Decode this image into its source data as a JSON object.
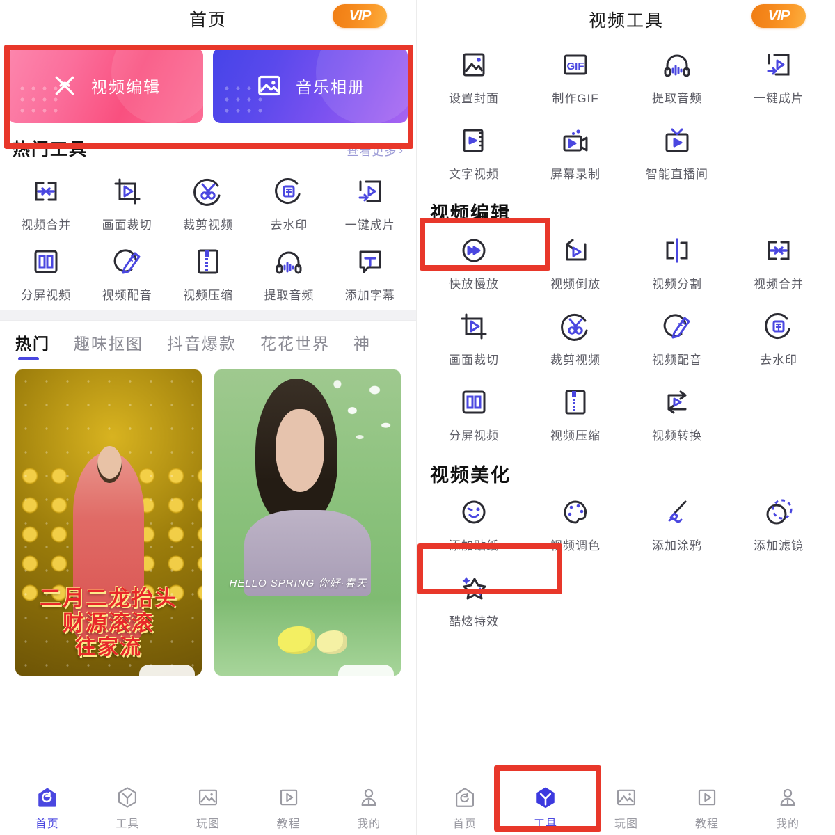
{
  "left": {
    "header": {
      "title": "首页",
      "vip_label": "VIP"
    },
    "banners": [
      {
        "label": "视频编辑",
        "icon": "scissors-x-icon",
        "color": "#f9507f"
      },
      {
        "label": "音乐相册",
        "icon": "photo-icon",
        "color": "#7c52f0"
      }
    ],
    "hot_tools": {
      "title": "热门工具",
      "more_label": "查看更多",
      "more_chevron": "›",
      "items": [
        {
          "label": "视频合并",
          "icon": "merge-icon"
        },
        {
          "label": "画面裁切",
          "icon": "crop-icon"
        },
        {
          "label": "裁剪视频",
          "icon": "scissors-icon"
        },
        {
          "label": "去水印",
          "icon": "watermark-icon"
        },
        {
          "label": "一键成片",
          "icon": "one-key-film-icon"
        },
        {
          "label": "分屏视频",
          "icon": "split-screen-icon"
        },
        {
          "label": "视频配音",
          "icon": "dubbing-icon"
        },
        {
          "label": "视频压缩",
          "icon": "compress-icon"
        },
        {
          "label": "提取音频",
          "icon": "headphone-icon"
        },
        {
          "label": "添加字幕",
          "icon": "subtitle-icon"
        }
      ]
    },
    "tabs": [
      {
        "label": "热门",
        "active": true
      },
      {
        "label": "趣味抠图",
        "active": false
      },
      {
        "label": "抖音爆款",
        "active": false
      },
      {
        "label": "花花世界",
        "active": false
      },
      {
        "label": "神",
        "active": false
      }
    ],
    "feed": [
      {
        "title_lines": [
          "二月二龙抬头",
          "财源滚滚",
          "往家流"
        ],
        "theme": "gold"
      },
      {
        "title_lines": [],
        "caption": "HELLO SPRING 你好·春天",
        "theme": "green"
      }
    ],
    "bottom_nav": [
      {
        "label": "首页",
        "icon": "home-icon",
        "active": true
      },
      {
        "label": "工具",
        "icon": "tools-hex-icon",
        "active": false
      },
      {
        "label": "玩图",
        "icon": "picture-icon",
        "active": false
      },
      {
        "label": "教程",
        "icon": "play-frame-icon",
        "active": false
      },
      {
        "label": "我的",
        "icon": "user-icon",
        "active": false
      }
    ]
  },
  "right": {
    "header": {
      "title": "视频工具",
      "vip_label": "VIP"
    },
    "top_tools": [
      {
        "label": "设置封面",
        "icon": "picture-icon"
      },
      {
        "label": "制作GIF",
        "icon": "gif-icon"
      },
      {
        "label": "提取音频",
        "icon": "headphone-icon"
      },
      {
        "label": "一键成片",
        "icon": "one-key-film-icon"
      },
      {
        "label": "文字视频",
        "icon": "text-video-icon"
      },
      {
        "label": "屏幕录制",
        "icon": "screen-record-icon"
      },
      {
        "label": "智能直播间",
        "icon": "tv-icon"
      }
    ],
    "groups": [
      {
        "title": "视频编辑",
        "highlighted": true,
        "items": [
          {
            "label": "快放慢放",
            "icon": "speed-icon"
          },
          {
            "label": "视频倒放",
            "icon": "reverse-icon"
          },
          {
            "label": "视频分割",
            "icon": "split-icon"
          },
          {
            "label": "视频合并",
            "icon": "merge-icon"
          },
          {
            "label": "画面裁切",
            "icon": "crop-icon"
          },
          {
            "label": "裁剪视频",
            "icon": "scissors-icon"
          },
          {
            "label": "视频配音",
            "icon": "dubbing-icon"
          },
          {
            "label": "去水印",
            "icon": "watermark-icon"
          },
          {
            "label": "分屏视频",
            "icon": "split-screen-icon"
          },
          {
            "label": "视频压缩",
            "icon": "compress-icon"
          },
          {
            "label": "视频转换",
            "icon": "convert-icon"
          }
        ]
      },
      {
        "title": "视频美化",
        "highlighted": true,
        "items": [
          {
            "label": "添加贴纸",
            "icon": "sticker-icon"
          },
          {
            "label": "视频调色",
            "icon": "palette-icon"
          },
          {
            "label": "添加涂鸦",
            "icon": "brush-icon"
          },
          {
            "label": "添加滤镜",
            "icon": "filter-icon"
          },
          {
            "label": "酷炫特效",
            "icon": "star-sparkle-icon"
          }
        ]
      }
    ],
    "bottom_nav": [
      {
        "label": "首页",
        "icon": "home-icon",
        "active": false
      },
      {
        "label": "工具",
        "icon": "tools-hex-icon",
        "active": true
      },
      {
        "label": "玩图",
        "icon": "picture-icon",
        "active": false
      },
      {
        "label": "教程",
        "icon": "play-frame-icon",
        "active": false
      },
      {
        "label": "我的",
        "icon": "user-icon",
        "active": false
      }
    ]
  },
  "annotations": {
    "color": "#e8372a",
    "boxes": [
      {
        "name": "banner-row-highlight"
      },
      {
        "name": "video-edit-group-highlight"
      },
      {
        "name": "video-beautify-group-highlight"
      },
      {
        "name": "tools-tab-highlight"
      }
    ]
  }
}
